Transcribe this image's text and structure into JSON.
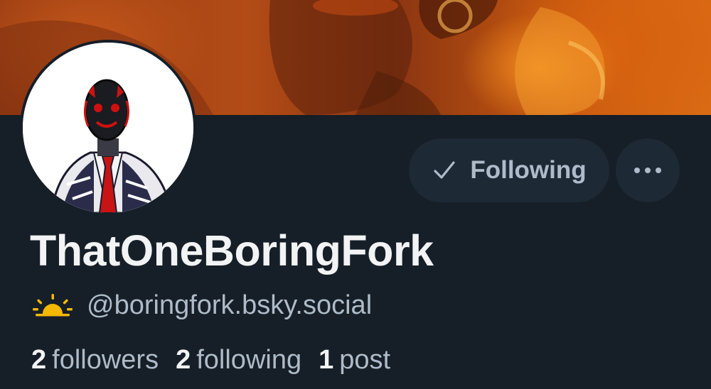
{
  "profile": {
    "display_name": "ThatOneBoringFork",
    "handle": "@boringfork.bsky.social",
    "handle_icon": "sunrise-icon",
    "follow_button_label": "Following",
    "follow_button_icon": "checkmark-icon",
    "more_button_icon": "ellipsis-icon",
    "avatar_description": "masked-figure-in-suit-avatar",
    "banner_description": "orange-mecha-banner"
  },
  "stats": [
    {
      "count": "2",
      "label": "followers"
    },
    {
      "count": "2",
      "label": "following"
    },
    {
      "count": "1",
      "label": "post"
    }
  ],
  "colors": {
    "background": "#161e27",
    "button_bg": "#1e2936",
    "muted_text": "#aebbc9",
    "primary_text": "#f1f3f5",
    "sun_icon": "#f5b800",
    "banner_accent": "#e0701a"
  }
}
